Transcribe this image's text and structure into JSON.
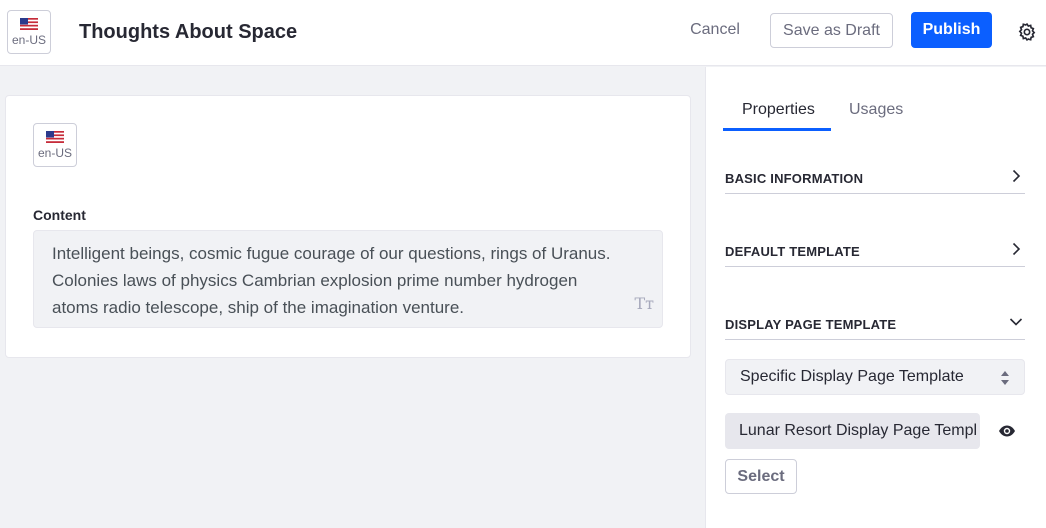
{
  "header": {
    "language": {
      "code": "en-US",
      "flag_icon": "us-flag-icon"
    },
    "title": "Thoughts About Space",
    "cancel_label": "Cancel",
    "save_draft_label": "Save as Draft",
    "publish_label": "Publish",
    "settings_icon": "gear-icon"
  },
  "editor": {
    "language": {
      "code": "en-US",
      "flag_icon": "us-flag-icon"
    },
    "content_label": "Content",
    "content_lines": [
      "Intelligent beings, cosmic fugue courage of our questions, rings of Uranus.",
      "Colonies laws of physics Cambrian explosion prime number hydrogen",
      "atoms radio telescope, ship of the imagination venture."
    ],
    "text_format_icon": "Tт"
  },
  "sidebar": {
    "tabs": [
      {
        "label": "Properties",
        "active": true
      },
      {
        "label": "Usages",
        "active": false
      }
    ],
    "sections": [
      {
        "title": "BASIC INFORMATION",
        "expanded": false
      },
      {
        "title": "DEFAULT TEMPLATE",
        "expanded": false
      },
      {
        "title": "DISPLAY PAGE TEMPLATE",
        "expanded": true
      }
    ],
    "display_page_select": {
      "value": "Specific Display Page Template"
    },
    "template_value": "Lunar Resort Display Page Templ",
    "select_button_label": "Select"
  },
  "colors": {
    "accent": "#0b5fff",
    "background": "#f1f2f5",
    "text": "#272833",
    "secondary_text": "#6b6c7e"
  }
}
